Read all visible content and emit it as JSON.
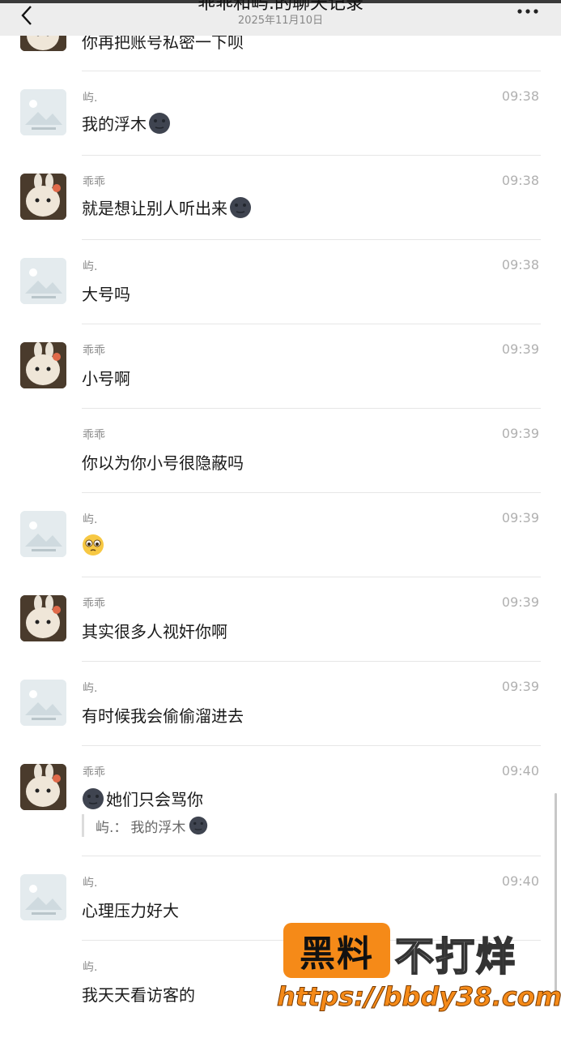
{
  "header": {
    "title": "乖乖和屿.的聊天记录",
    "date": "2025年11月10日"
  },
  "partial_top_message": "你再把账号私密一下呗",
  "messages": [
    {
      "sender": "屿.",
      "time": "09:38",
      "text": "我的浮木",
      "avatar": "default",
      "emoji_after": "new-moon-face"
    },
    {
      "sender": "乖乖",
      "time": "09:38",
      "text": "就是想让别人听出来",
      "avatar": "cute",
      "emoji_after": "new-moon-face"
    },
    {
      "sender": "屿.",
      "time": "09:38",
      "text": "大号吗",
      "avatar": "default"
    },
    {
      "sender": "乖乖",
      "time": "09:39",
      "text": "小号啊",
      "avatar": "cute"
    },
    {
      "sender": "乖乖",
      "time": "09:39",
      "text": "你以为你小号很隐蔽吗",
      "avatar": "none"
    },
    {
      "sender": "屿.",
      "time": "09:39",
      "text": "",
      "avatar": "default",
      "emoji_only": "pleading-face"
    },
    {
      "sender": "乖乖",
      "time": "09:39",
      "text": "其实很多人视奸你啊",
      "avatar": "cute"
    },
    {
      "sender": "屿.",
      "time": "09:39",
      "text": "有时候我会偷偷溜进去",
      "avatar": "default"
    },
    {
      "sender": "乖乖",
      "time": "09:40",
      "text": "她们只会骂你",
      "avatar": "cute",
      "emoji_before": "new-moon-face",
      "quote": {
        "sender": "屿.：",
        "text": "我的浮木",
        "emoji": "new-moon-face"
      }
    },
    {
      "sender": "屿.",
      "time": "09:40",
      "text": "心理压力好大",
      "avatar": "default"
    },
    {
      "sender": "屿.",
      "time": "",
      "text": "我天天看访客的",
      "avatar": "none"
    }
  ],
  "watermark": {
    "badge": "黑料",
    "text": "不打烊",
    "url": "https://bbdy38.com"
  },
  "colors": {
    "header_bg": "#ededed",
    "name": "#8a8a8a",
    "time": "#b0b0b0",
    "watermark_orange": "#f58a18"
  }
}
